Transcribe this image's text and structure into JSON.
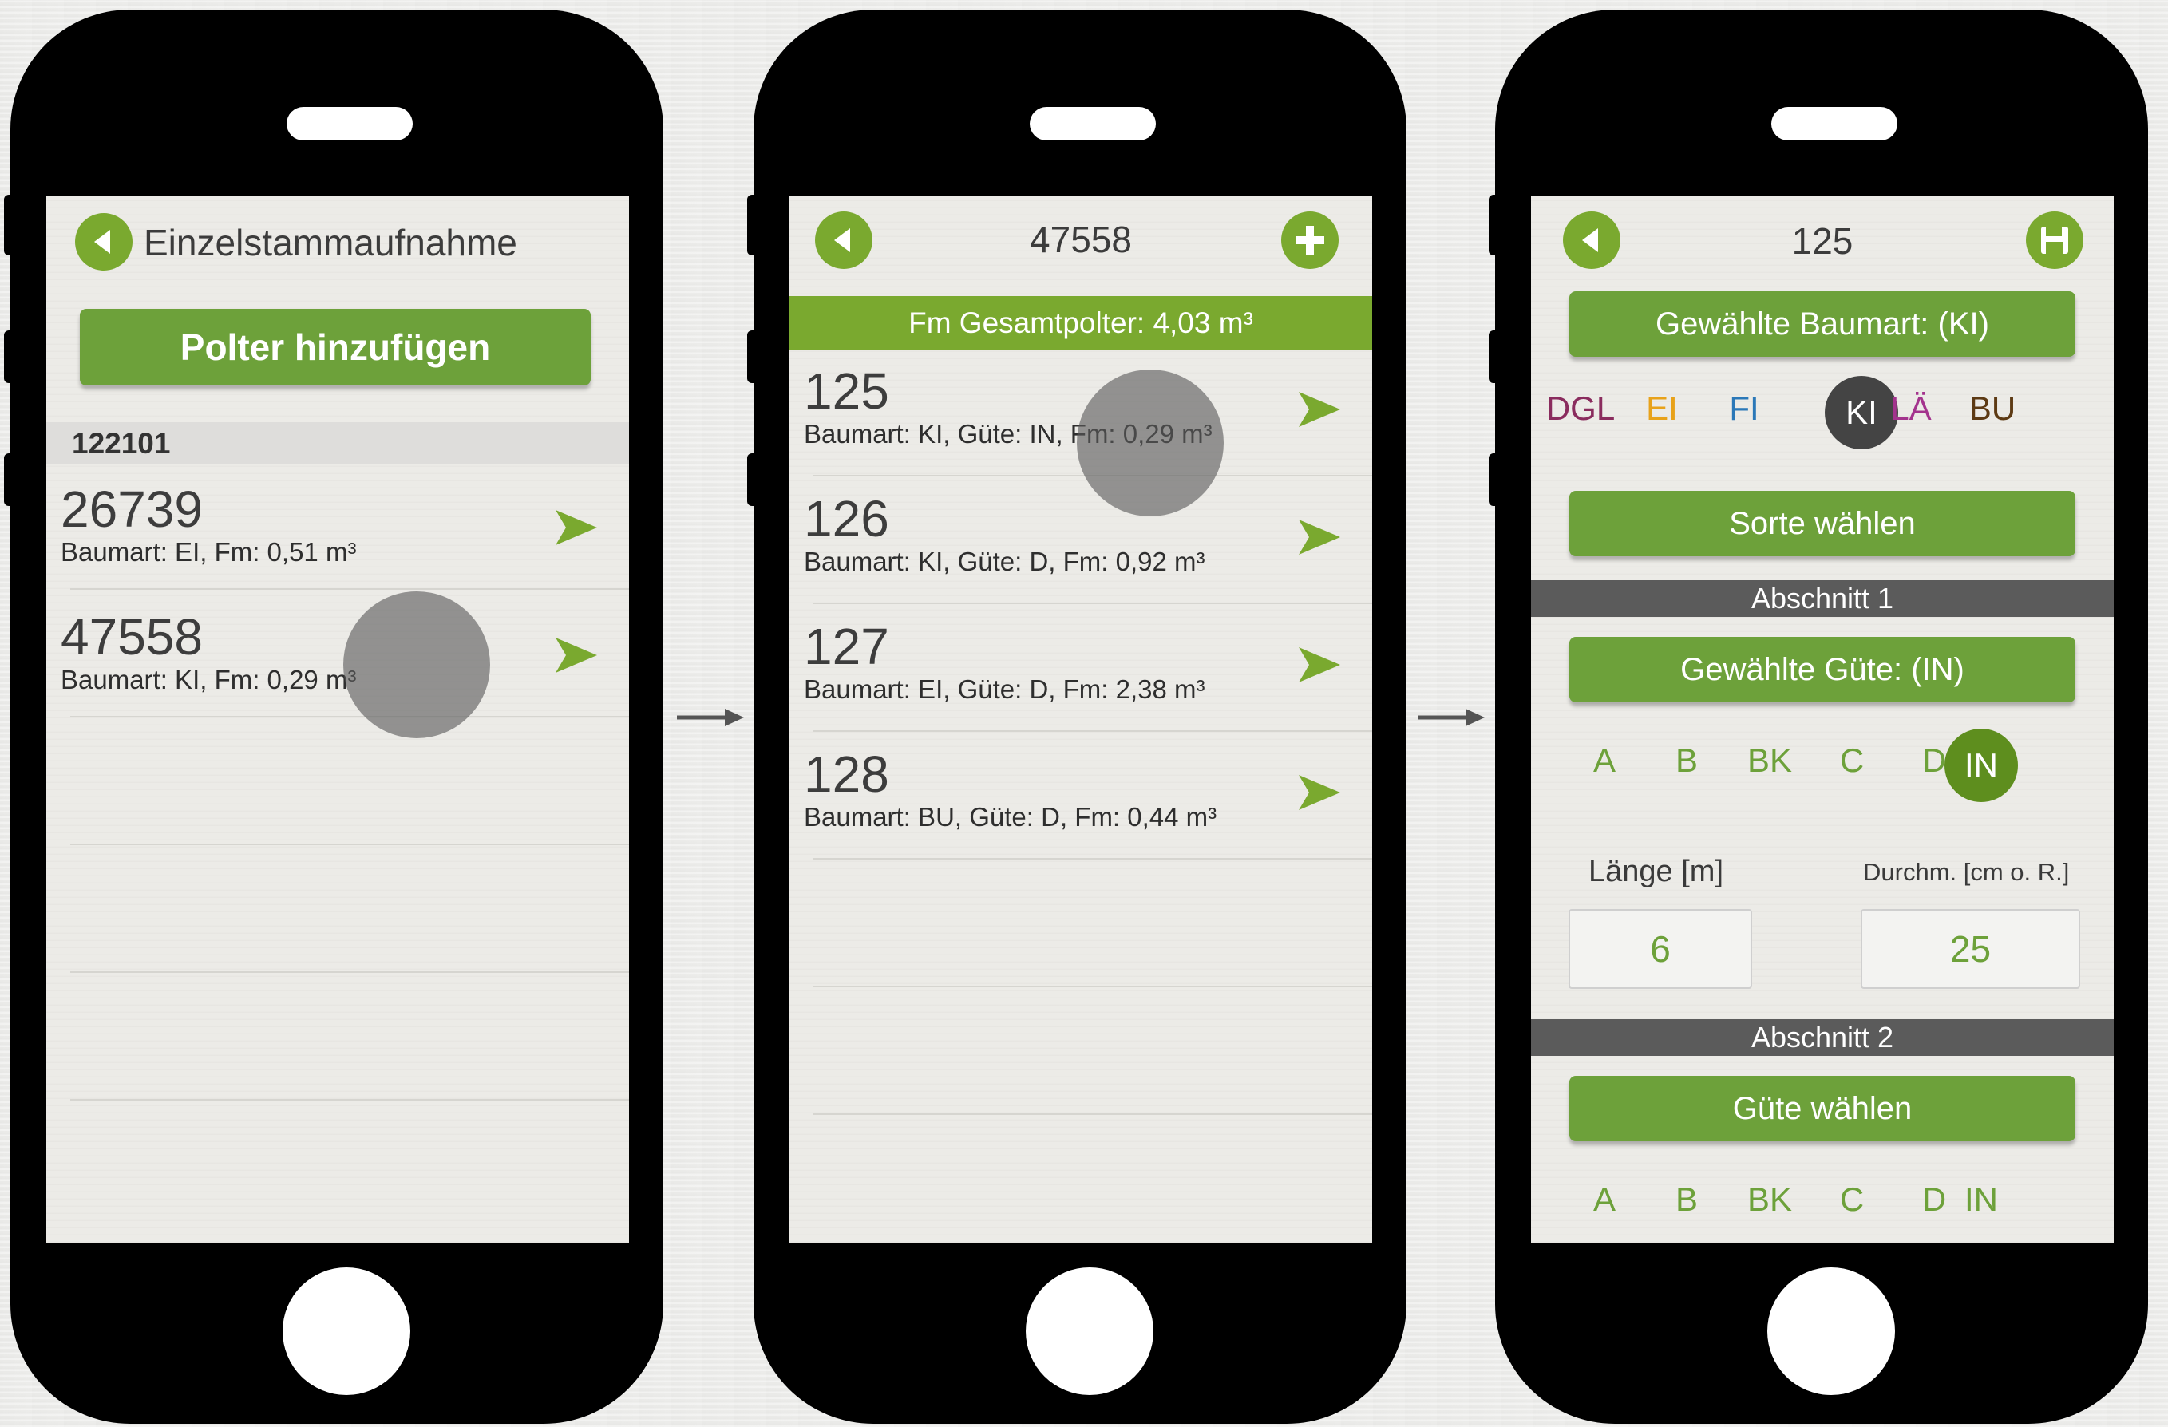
{
  "screen1": {
    "title": "Einzelstammaufnahme",
    "add_button": "Polter hinzufügen",
    "group_header": "122101",
    "rows": [
      {
        "number": "26739",
        "details": "Baumart: EI, Fm: 0,51 m³"
      },
      {
        "number": "47558",
        "details": "Baumart: KI, Fm: 0,29 m³"
      }
    ]
  },
  "screen2": {
    "title": "47558",
    "summary": "Fm Gesamtpolter: 4,03 m³",
    "rows": [
      {
        "number": "125",
        "details": "Baumart: KI, Güte: IN, Fm: 0,29 m³"
      },
      {
        "number": "126",
        "details": "Baumart: KI, Güte: D, Fm: 0,92 m³"
      },
      {
        "number": "127",
        "details": "Baumart: EI, Güte: D, Fm: 2,38 m³"
      },
      {
        "number": "128",
        "details": "Baumart: BU, Güte: D, Fm: 0,44 m³"
      }
    ]
  },
  "screen3": {
    "title": "125",
    "species_button": "Gewählte Baumart: (KI)",
    "species": [
      {
        "label": "DGL",
        "color": "#8a2c5e",
        "selected": false
      },
      {
        "label": "EI",
        "color": "#e8a21a",
        "selected": false
      },
      {
        "label": "FI",
        "color": "#2b78b8",
        "selected": false
      },
      {
        "label": "KI",
        "color": "#444444",
        "selected": true
      },
      {
        "label": "LÄ",
        "color": "#a3338d",
        "selected": false
      },
      {
        "label": "BU",
        "color": "#5d3a14",
        "selected": false
      }
    ],
    "sort_button": "Sorte wählen",
    "section1": "Abschnitt 1",
    "quality_button": "Gewählte Güte: (IN)",
    "qualities1": [
      {
        "label": "A",
        "selected": false
      },
      {
        "label": "B",
        "selected": false
      },
      {
        "label": "BK",
        "selected": false
      },
      {
        "label": "C",
        "selected": false
      },
      {
        "label": "D",
        "selected": false
      },
      {
        "label": "IN",
        "selected": true
      }
    ],
    "length_label": "Länge [m]",
    "diameter_label": "Durchm. [cm o. R.]",
    "length_value": "6",
    "diameter_value": "25",
    "section2": "Abschnitt 2",
    "quality2_button": "Güte wählen",
    "qualities2": [
      "A",
      "B",
      "BK",
      "C",
      "D",
      "IN"
    ]
  },
  "colors": {
    "accent_green": "#6da13a",
    "selected_species_bg": "#444444",
    "selected_quality_bg": "#5e8e1e",
    "section_bar": "#5b5b5b"
  },
  "icons": {
    "back": "back-arrow-icon",
    "add": "plus-icon",
    "save": "save-icon",
    "row_arrow": "chevron-right-icon",
    "flow": "flow-arrow-icon"
  }
}
